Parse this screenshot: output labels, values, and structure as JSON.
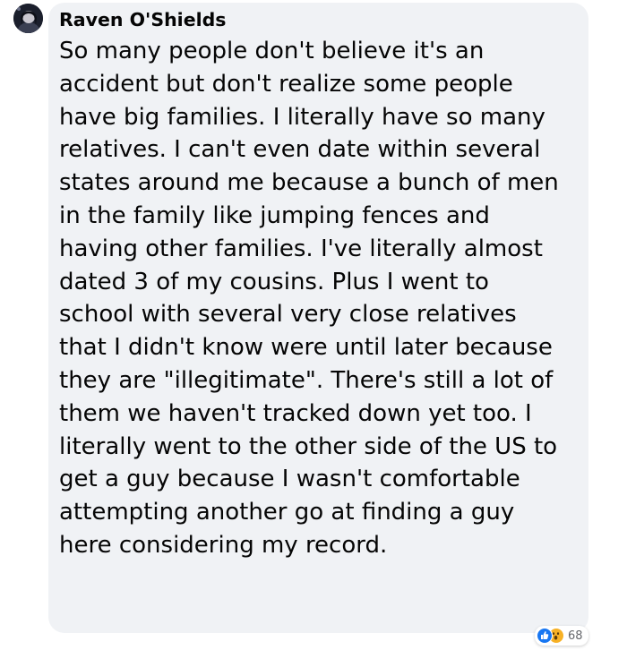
{
  "comment": {
    "author": "Raven O'Shields",
    "text": "So many people don't believe it's an accident but don't realize some people have big families. I literally have so many relatives. I can't even date within several states around me because a bunch of men in the family like jumping fences and having other families. I've literally almost dated 3 of my cousins. Plus I went to school with several very close relatives that I didn't know were until later because they are \"illegitimate\". There's still a lot of them we haven't tracked down yet too. I literally went to the other side of the US to get a guy because I wasn't comfortable attempting another go at finding a guy here considering my record.",
    "reactions": {
      "icons": [
        "like-icon",
        "wow-icon"
      ],
      "count": "68"
    }
  },
  "colors": {
    "bubble_bg": "#f0f2f5",
    "text": "#050505",
    "like": "#1877f2",
    "wow": "#f7b125",
    "count": "#65676b"
  }
}
